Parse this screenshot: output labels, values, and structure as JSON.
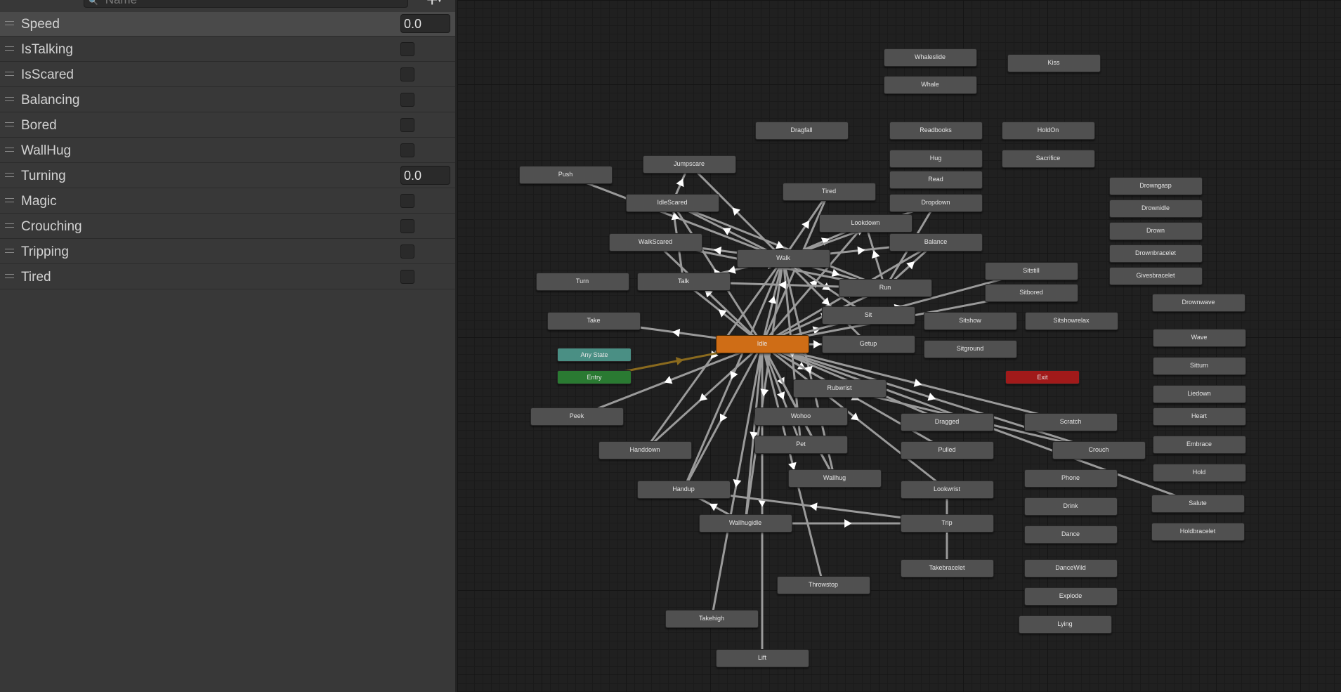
{
  "search": {
    "placeholder": "Name"
  },
  "toolbar": {
    "add_label": "+",
    "caret": "▾"
  },
  "colors": {
    "default_state": "#cf6d16",
    "state": "#505050",
    "any_state": "#4a8f84",
    "entry": "#2a7a32",
    "exit": "#a11a1a",
    "transition": "#9a9a9a",
    "default_transition": "#8a6a1e"
  },
  "parameters": [
    {
      "name": "Speed",
      "type": "float",
      "value": "0.0",
      "selected": true
    },
    {
      "name": "IsTalking",
      "type": "bool"
    },
    {
      "name": "IsScared",
      "type": "bool"
    },
    {
      "name": "Balancing",
      "type": "bool"
    },
    {
      "name": "Bored",
      "type": "bool"
    },
    {
      "name": "WallHug",
      "type": "bool"
    },
    {
      "name": "Turning",
      "type": "float",
      "value": "0.0"
    },
    {
      "name": "Magic",
      "type": "bool"
    },
    {
      "name": "Crouching",
      "type": "bool"
    },
    {
      "name": "Tripping",
      "type": "bool"
    },
    {
      "name": "Tired",
      "type": "bool"
    }
  ],
  "states": [
    {
      "id": "Whaleslide",
      "label": "Whaleslide"
    },
    {
      "id": "Whale",
      "label": "Whale"
    },
    {
      "id": "Kiss",
      "label": "Kiss"
    },
    {
      "id": "Dragfall",
      "label": "Dragfall"
    },
    {
      "id": "Readbooks",
      "label": "Readbooks"
    },
    {
      "id": "HoldOn",
      "label": "HoldOn"
    },
    {
      "id": "Hug",
      "label": "Hug"
    },
    {
      "id": "Sacrifice",
      "label": "Sacrifice"
    },
    {
      "id": "Read",
      "label": "Read"
    },
    {
      "id": "Dropdown",
      "label": "Dropdown"
    },
    {
      "id": "Jumpscare",
      "label": "Jumpscare"
    },
    {
      "id": "Push",
      "label": "Push"
    },
    {
      "id": "IdleScared",
      "label": "IdleScared"
    },
    {
      "id": "Tired",
      "label": "Tired"
    },
    {
      "id": "Lookdown",
      "label": "Lookdown"
    },
    {
      "id": "WalkScared",
      "label": "WalkScared"
    },
    {
      "id": "Balance",
      "label": "Balance"
    },
    {
      "id": "Walk",
      "label": "Walk"
    },
    {
      "id": "Turn",
      "label": "Turn"
    },
    {
      "id": "Talk",
      "label": "Talk"
    },
    {
      "id": "Run",
      "label": "Run"
    },
    {
      "id": "Sitstill",
      "label": "Sitstill"
    },
    {
      "id": "Sitbored",
      "label": "Sitbored"
    },
    {
      "id": "Sit",
      "label": "Sit"
    },
    {
      "id": "Take",
      "label": "Take"
    },
    {
      "id": "Sitshow",
      "label": "Sitshow"
    },
    {
      "id": "Sitshowrelax",
      "label": "Sitshowrelax"
    },
    {
      "id": "Idle",
      "label": "Idle",
      "kind": "default"
    },
    {
      "id": "Getup",
      "label": "Getup"
    },
    {
      "id": "Sitground",
      "label": "Sitground"
    },
    {
      "id": "AnyState",
      "label": "Any State",
      "kind": "anystate"
    },
    {
      "id": "Entry",
      "label": "Entry",
      "kind": "entry"
    },
    {
      "id": "Exit",
      "label": "Exit",
      "kind": "exit"
    },
    {
      "id": "Rubwrist",
      "label": "Rubwrist"
    },
    {
      "id": "Peek",
      "label": "Peek"
    },
    {
      "id": "Wohoo",
      "label": "Wohoo"
    },
    {
      "id": "Dragged",
      "label": "Dragged"
    },
    {
      "id": "Scratch",
      "label": "Scratch"
    },
    {
      "id": "Handdown",
      "label": "Handdown"
    },
    {
      "id": "Pet",
      "label": "Pet"
    },
    {
      "id": "Pulled",
      "label": "Pulled"
    },
    {
      "id": "Crouch",
      "label": "Crouch"
    },
    {
      "id": "Wallhug",
      "label": "Wallhug"
    },
    {
      "id": "Handup",
      "label": "Handup"
    },
    {
      "id": "Lookwrist",
      "label": "Lookwrist"
    },
    {
      "id": "Phone",
      "label": "Phone"
    },
    {
      "id": "Drink",
      "label": "Drink"
    },
    {
      "id": "Wallhugidle",
      "label": "Wallhugidle"
    },
    {
      "id": "Trip",
      "label": "Trip"
    },
    {
      "id": "Dance",
      "label": "Dance"
    },
    {
      "id": "Takebracelet",
      "label": "Takebracelet"
    },
    {
      "id": "DanceWild",
      "label": "DanceWild"
    },
    {
      "id": "Throwstop",
      "label": "Throwstop"
    },
    {
      "id": "Explode",
      "label": "Explode"
    },
    {
      "id": "Takehigh",
      "label": "Takehigh"
    },
    {
      "id": "Lying",
      "label": "Lying"
    },
    {
      "id": "Lift",
      "label": "Lift"
    },
    {
      "id": "Drowngasp",
      "label": "Drowngasp"
    },
    {
      "id": "Drownidle",
      "label": "Drownidle"
    },
    {
      "id": "Drown",
      "label": "Drown"
    },
    {
      "id": "Drownbracelet",
      "label": "Drownbracelet"
    },
    {
      "id": "Givesbracelet",
      "label": "Givesbracelet"
    },
    {
      "id": "Drownwave",
      "label": "Drownwave"
    },
    {
      "id": "Wave",
      "label": "Wave"
    },
    {
      "id": "Sitturn",
      "label": "Sitturn"
    },
    {
      "id": "Liedown",
      "label": "Liedown"
    },
    {
      "id": "Heart",
      "label": "Heart"
    },
    {
      "id": "Embrace",
      "label": "Embrace"
    },
    {
      "id": "Hold",
      "label": "Hold"
    },
    {
      "id": "Salute",
      "label": "Salute"
    },
    {
      "id": "Holdbracelet",
      "label": "Holdbracelet"
    }
  ],
  "transitions": [
    [
      "Idle",
      "Walk"
    ],
    [
      "Idle",
      "Run"
    ],
    [
      "Idle",
      "Talk"
    ],
    [
      "Idle",
      "IdleScared"
    ],
    [
      "Idle",
      "WalkScared"
    ],
    [
      "Idle",
      "Lookdown"
    ],
    [
      "Idle",
      "Tired"
    ],
    [
      "Idle",
      "Balance"
    ],
    [
      "Idle",
      "Take"
    ],
    [
      "Idle",
      "Sit"
    ],
    [
      "Idle",
      "Getup"
    ],
    [
      "Idle",
      "Rubwrist"
    ],
    [
      "Idle",
      "Wohoo"
    ],
    [
      "Idle",
      "Pet"
    ],
    [
      "Idle",
      "Wallhug"
    ],
    [
      "Idle",
      "Handup"
    ],
    [
      "Idle",
      "Handdown"
    ],
    [
      "Idle",
      "Peek"
    ],
    [
      "Idle",
      "Wallhugidle"
    ],
    [
      "Idle",
      "Throwstop"
    ],
    [
      "Idle",
      "Takehigh"
    ],
    [
      "Idle",
      "Lift"
    ],
    [
      "Idle",
      "Dragged"
    ],
    [
      "Idle",
      "Lookwrist"
    ],
    [
      "Idle",
      "Scratch"
    ],
    [
      "Idle",
      "Crouch"
    ],
    [
      "Idle",
      "Salute"
    ],
    [
      "Idle",
      "Sitbored"
    ],
    [
      "Idle",
      "Sitstill"
    ],
    [
      "Idle",
      "Pulled"
    ],
    [
      "Walk",
      "Run"
    ],
    [
      "Walk",
      "Talk"
    ],
    [
      "Walk",
      "IdleScared"
    ],
    [
      "Walk",
      "WalkScared"
    ],
    [
      "Walk",
      "Lookdown"
    ],
    [
      "Walk",
      "Tired"
    ],
    [
      "Walk",
      "Balance"
    ],
    [
      "Walk",
      "Handdown"
    ],
    [
      "Walk",
      "Handup"
    ],
    [
      "Walk",
      "Wallhugidle"
    ],
    [
      "Walk",
      "Pet"
    ],
    [
      "Walk",
      "Wallhug"
    ],
    [
      "Walk",
      "Getup"
    ],
    [
      "Walk",
      "Sit"
    ],
    [
      "Walk",
      "Jumpscare"
    ],
    [
      "Walk",
      "Dropdown"
    ],
    [
      "Run",
      "Balance"
    ],
    [
      "Run",
      "Lookdown"
    ],
    [
      "Run",
      "Talk"
    ],
    [
      "Run",
      "Dropdown"
    ],
    [
      "IdleScared",
      "Talk"
    ],
    [
      "IdleScared",
      "Run"
    ],
    [
      "IdleScared",
      "Jumpscare"
    ],
    [
      "WalkScared",
      "Run"
    ],
    [
      "Push",
      "Walk"
    ],
    [
      "Entry",
      "Idle"
    ],
    [
      "Wallhugidle",
      "Handup"
    ],
    [
      "Wallhugidle",
      "Trip"
    ],
    [
      "Lookwrist",
      "Takebracelet"
    ],
    [
      "Wallhug",
      "Wohoo"
    ],
    [
      "Trip",
      "Handup"
    ],
    [
      "Rubwrist",
      "Crouch"
    ]
  ]
}
